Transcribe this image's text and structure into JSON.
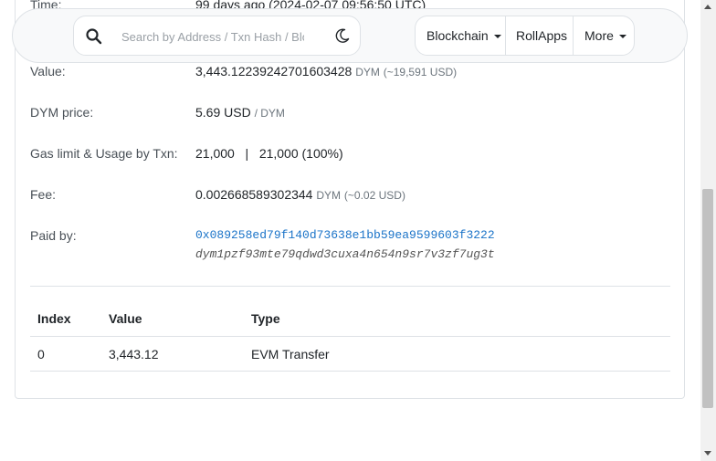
{
  "header": {
    "search_placeholder": "Search by Address / Txn Hash / Block / Token",
    "nav": [
      {
        "label": "Blockchain"
      },
      {
        "label": "RollApps"
      },
      {
        "label": "More"
      }
    ]
  },
  "details": {
    "time": {
      "label": "Time:",
      "value": "99 days ago (2024-02-07 09:56:50 UTC)"
    },
    "value": {
      "label": "Value:",
      "amount": "3,443.12239242701603428",
      "unit": "DYM",
      "fiat": "(~19,591 USD)"
    },
    "price": {
      "label": "DYM price:",
      "value": "5.69 USD",
      "unit": "/ DYM"
    },
    "gas": {
      "label": "Gas limit & Usage by Txn:",
      "limit": "21,000",
      "separator": "|",
      "usage": "21,000 (100%)"
    },
    "fee": {
      "label": "Fee:",
      "amount": "0.002668589302344",
      "unit": "DYM",
      "fiat": "(~0.02 USD)"
    },
    "paid_by": {
      "label": "Paid by:",
      "hex": "0x089258ed79f140d73638e1bb59ea9599603f3222",
      "bech32": "dym1pzf93mte79qdwd3cuxa4n654n9sr7v3zf7ug3t"
    }
  },
  "table": {
    "headers": [
      "Index",
      "Value",
      "Type"
    ],
    "rows": [
      {
        "index": "0",
        "value": "3,443.12",
        "type": "EVM Transfer"
      }
    ]
  }
}
